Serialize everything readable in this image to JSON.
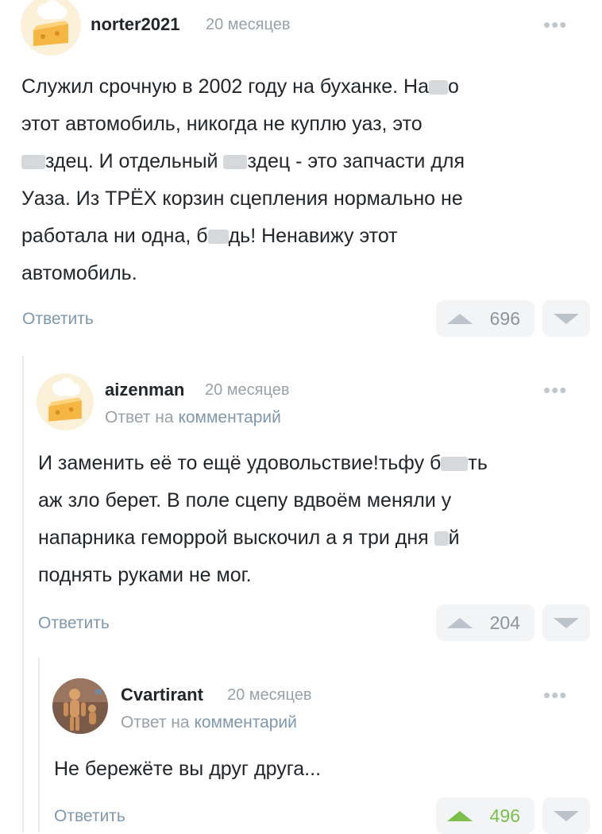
{
  "comments": [
    {
      "author": "norter2021",
      "time": "20 месяцев",
      "more_icon": "•••",
      "reply_to": null,
      "lines": [
        [
          "Служил срочную в 2002 году на буханке. На",
          "",
          "о"
        ],
        [
          "этот автомобиль, никогда не куплю уаз, это"
        ],
        [
          "",
          "",
          "здец. И отдельный ",
          "",
          "здец - это запчасти для"
        ],
        [
          "Уаза. Из ТРЁХ корзин сцепления нормально не"
        ],
        [
          "работала ни одна, б",
          "",
          "дь! Ненавижу этот"
        ],
        [
          "автомобиль."
        ]
      ],
      "reply_label": "Ответить",
      "rating": "696",
      "upvoted": false
    },
    {
      "author": "aizenman",
      "time": "20 месяцев",
      "more_icon": "•••",
      "reply_to": {
        "prefix": "Ответ на",
        "link": "комментарий"
      },
      "lines": [
        [
          "И заменить её то ещё удовольствие!тьфу б",
          "",
          "ть"
        ],
        [
          "аж зло берет. В поле сцепу вдвоём меняли у"
        ],
        [
          "напарника геморрой выскочил а я три дня ",
          "",
          "й"
        ],
        [
          "поднять руками не мог."
        ]
      ],
      "reply_label": "Ответить",
      "rating": "204",
      "upvoted": false
    },
    {
      "author": "Cvartirant",
      "time": "20 месяцев",
      "more_icon": "•••",
      "reply_to": {
        "prefix": "Ответ на",
        "link": "комментарий"
      },
      "lines": [
        [
          "Не бережёте вы друг друга..."
        ]
      ],
      "reply_label": "Ответить",
      "rating": "496",
      "upvoted": true
    }
  ],
  "colors": {
    "link": "#7f98ad",
    "muted": "#9aa1a9",
    "upvote_active": "#7bbf4d",
    "thread_line": "#e6e8eb"
  },
  "icons": {
    "avatar_1": "cheese-chef-avatar",
    "avatar_2": "cheese-chef-avatar",
    "avatar_3": "wooden-figure-avatar",
    "more": "more-dots-icon",
    "upvote": "upvote-arrow-icon",
    "downvote": "downvote-arrow-icon"
  }
}
